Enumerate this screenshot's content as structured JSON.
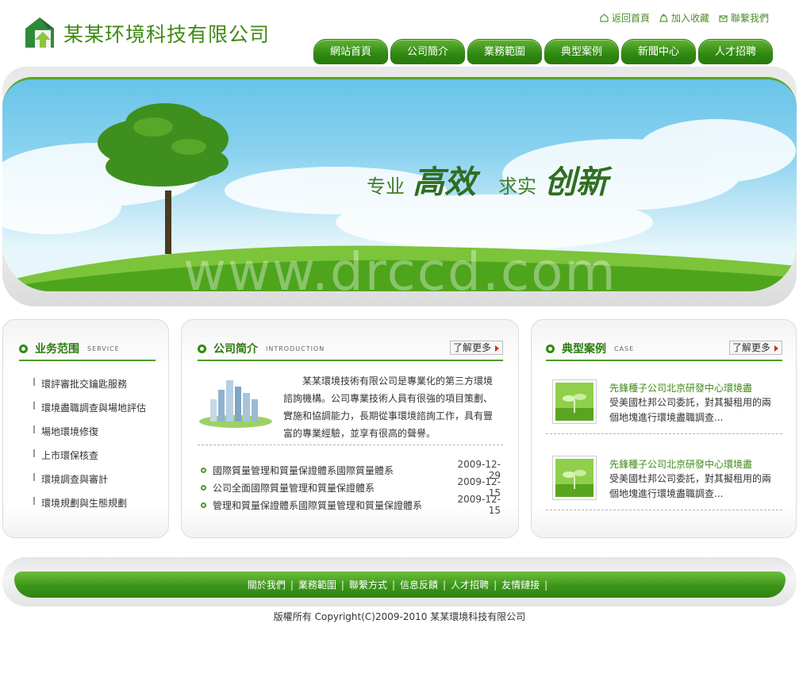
{
  "company": {
    "name": "某某环境科技有限公司"
  },
  "toplinks": [
    {
      "label": "返回首頁",
      "icon": "home-icon"
    },
    {
      "label": "加入收藏",
      "icon": "favorite-icon"
    },
    {
      "label": "聯繫我們",
      "icon": "contact-icon"
    }
  ],
  "nav": [
    "網站首頁",
    "公司簡介",
    "業務範圍",
    "典型案例",
    "新聞中心",
    "人才招聘"
  ],
  "banner": {
    "slogan": [
      "专业",
      "高效",
      "求实",
      "创新"
    ],
    "watermark": "www.drccd.com"
  },
  "services": {
    "title": "业务范围",
    "subtitle": "SERVICE",
    "items": [
      "環評審批交鑰匙服務",
      "環境盡職調查與場地評估",
      "場地環境修復",
      "上市環保核查",
      "環境調查與審計",
      "環境規劃與生態規劃"
    ]
  },
  "about": {
    "title": "公司简介",
    "subtitle": "INTRODUCTION",
    "more": "了解更多",
    "text": "某某環境技術有限公司是專業化的第三方環境諮詢機構。公司專業技術人員有很強的項目策劃、實施和協調能力，長期從事環境諮詢工作，具有豐富的專業經驗，並享有很高的聲譽。",
    "news": [
      {
        "title": "國際質量管理和質量保證體系國際質量體系",
        "date": "2009-12-29"
      },
      {
        "title": "公司全面國際質量管理和質量保證體系",
        "date": "2009-12-15"
      },
      {
        "title": "管理和質量保證體系國際質量管理和質量保證體系",
        "date": "2009-12-15"
      }
    ]
  },
  "cases": {
    "title": "典型案例",
    "subtitle": "CASE",
    "more": "了解更多",
    "items": [
      {
        "title": "先鋒種子公司北京研發中心環境盡",
        "desc": "受美國杜邦公司委託，對其擬租用的兩個地塊進行環境盡職調查..."
      },
      {
        "title": "先鋒種子公司北京研發中心環境盡",
        "desc": "受美國杜邦公司委託，對其擬租用的兩個地塊進行環境盡職調查..."
      }
    ]
  },
  "footer": {
    "links": [
      "關於我們",
      "業務範圍",
      "聯繫方式",
      "信息反饋",
      "人才招聘",
      "友情鏈接"
    ],
    "copyright": "版權所有 Copyright(C)2009-2010 某某環境科技有限公司"
  },
  "colors": {
    "brand": "#3f8a15",
    "nav": "#2f8a12",
    "sky": "#8ad2ef"
  }
}
